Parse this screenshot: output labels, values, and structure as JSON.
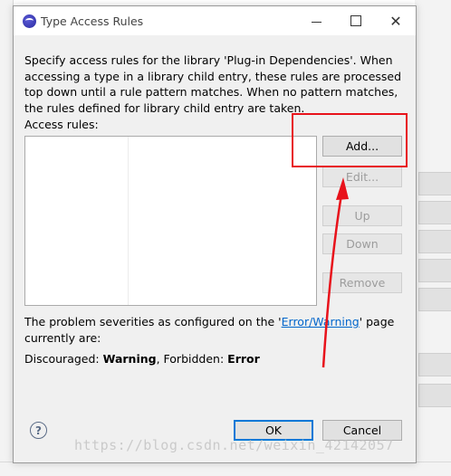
{
  "dialog": {
    "title": "Type Access Rules",
    "description": "Specify access rules for the library 'Plug-in Dependencies'. When accessing a type in a library child entry, these rules are processed top down until a rule pattern matches. When no pattern matches, the rules defined for library child entry are taken.",
    "access_rules_label": "Access rules:",
    "buttons": {
      "add": "Add...",
      "edit": "Edit...",
      "up": "Up",
      "down": "Down",
      "remove": "Remove",
      "ok": "OK",
      "cancel": "Cancel"
    },
    "severity_prefix": "The problem severities as configured on the '",
    "severity_link": "Error/Warning",
    "severity_suffix": "' page currently are:",
    "discouraged_label": "Discouraged: ",
    "discouraged_value": "Warning",
    "forbidden_label": ", Forbidden: ",
    "forbidden_value": "Error"
  },
  "icons": {
    "app": "eclipse-icon",
    "help": "help-icon",
    "minimize": "minimize-icon",
    "maximize": "maximize-icon",
    "close": "close-icon"
  },
  "watermark": "https://blog.csdn.net/weixin_42142057",
  "colors": {
    "annotation": "#e8121b",
    "link": "#0066cc",
    "default_button_border": "#0078d7"
  }
}
